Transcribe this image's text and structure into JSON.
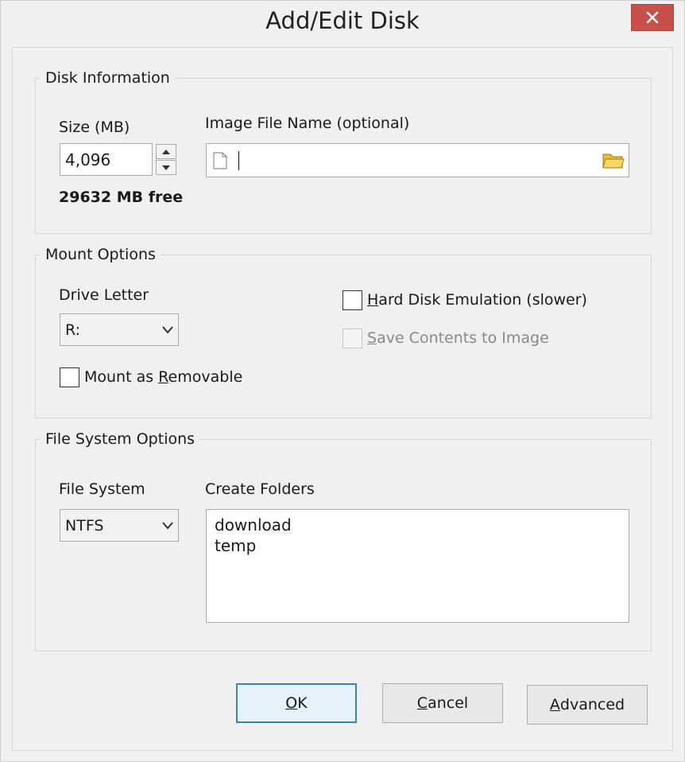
{
  "window": {
    "title": "Add/Edit Disk"
  },
  "disk_information": {
    "legend": "Disk Information",
    "size_label": "Size (MB)",
    "size_value": "4,096",
    "free_text": "29632 MB free",
    "image_file_label": "Image File Name (optional)",
    "image_file_value": ""
  },
  "mount_options": {
    "legend": "Mount Options",
    "drive_letter_label": "Drive Letter",
    "drive_letter_value": "R:",
    "hard_disk_emulation": {
      "pre": "",
      "mnemonic": "H",
      "post": "ard Disk Emulation (slower)",
      "checked": false
    },
    "save_contents": {
      "pre": "",
      "mnemonic": "S",
      "post": "ave Contents to Image",
      "checked": false,
      "disabled": true
    },
    "mount_removable": {
      "pre": "Mount as ",
      "mnemonic": "R",
      "post": "emovable",
      "checked": false
    }
  },
  "file_system_options": {
    "legend": "File System Options",
    "file_system_label": "File System",
    "file_system_value": "NTFS",
    "create_folders_label": "Create Folders",
    "folders": [
      "download",
      "temp"
    ]
  },
  "buttons": {
    "ok": {
      "mnemonic": "O",
      "post": "K"
    },
    "cancel": {
      "mnemonic": "C",
      "post": "ancel"
    },
    "advanced": {
      "mnemonic": "A",
      "post": "dvanced"
    }
  },
  "icons": {
    "close": "close-icon",
    "file": "file-icon",
    "folder": "folder-icon",
    "spin_up": "spin-up-icon",
    "spin_down": "spin-down-icon",
    "dropdown": "chevron-down-icon"
  },
  "colors": {
    "close_button": "#c7504a",
    "default_button_border": "#3c7fb1",
    "folder_icon": "#f2d04a"
  }
}
